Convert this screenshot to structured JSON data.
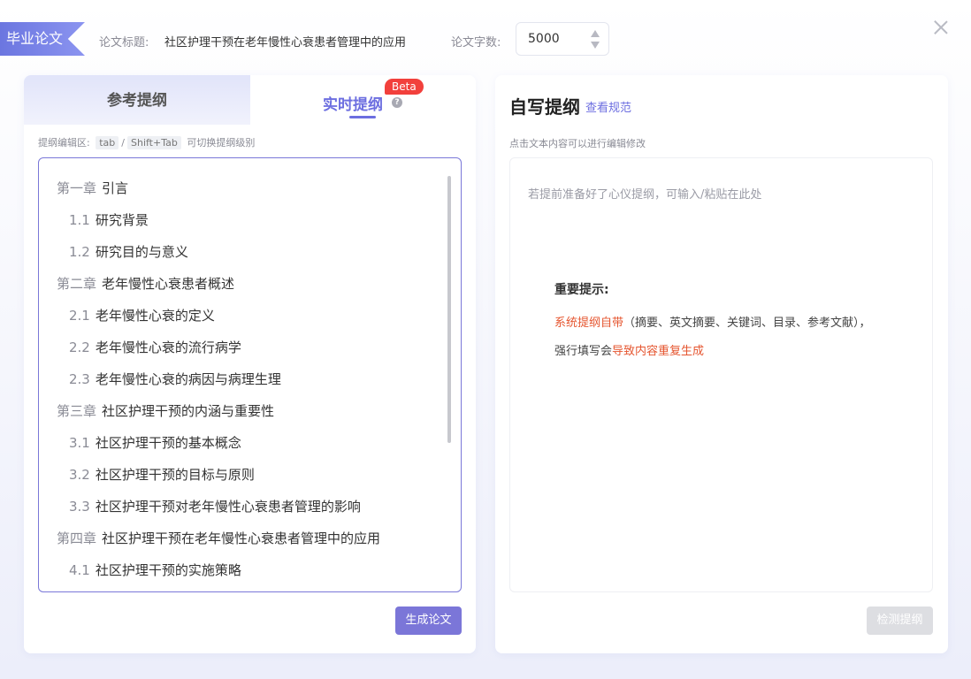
{
  "header": {
    "tag": "毕业论文",
    "title_label": "论文标题:",
    "title_value": "社区护理干预在老年慢性心衰患者管理中的应用",
    "count_label": "论文字数:",
    "count_value": "5000"
  },
  "left": {
    "tab_ref": "参考提纲",
    "tab_live": "实时提纲",
    "beta": "Beta",
    "hint_prefix": "提纲编辑区:",
    "key_tab": "tab",
    "sep": "/",
    "key_shift": "Shift+Tab",
    "hint_suffix": "可切换提纲级别",
    "outline": [
      {
        "level": "ch",
        "num": "第一章",
        "text": "引言"
      },
      {
        "level": "sec",
        "num": "1.1",
        "text": "研究背景"
      },
      {
        "level": "sec",
        "num": "1.2",
        "text": "研究目的与意义"
      },
      {
        "level": "ch",
        "num": "第二章",
        "text": "老年慢性心衰患者概述"
      },
      {
        "level": "sec",
        "num": "2.1",
        "text": "老年慢性心衰的定义"
      },
      {
        "level": "sec",
        "num": "2.2",
        "text": "老年慢性心衰的流行病学"
      },
      {
        "level": "sec",
        "num": "2.3",
        "text": "老年慢性心衰的病因与病理生理"
      },
      {
        "level": "ch",
        "num": "第三章",
        "text": "社区护理干预的内涵与重要性"
      },
      {
        "level": "sec",
        "num": "3.1",
        "text": "社区护理干预的基本概念"
      },
      {
        "level": "sec",
        "num": "3.2",
        "text": "社区护理干预的目标与原则"
      },
      {
        "level": "sec",
        "num": "3.3",
        "text": "社区护理干预对老年慢性心衰患者管理的影响"
      },
      {
        "level": "ch",
        "num": "第四章",
        "text": "社区护理干预在老年慢性心衰患者管理中的应用"
      },
      {
        "level": "sec",
        "num": "4.1",
        "text": "社区护理干预的实施策略"
      }
    ],
    "generate_btn": "生成论文"
  },
  "right": {
    "title": "自写提纲",
    "spec_link": "查看规范",
    "hint": "点击文本内容可以进行编辑修改",
    "placeholder": "若提前准备好了心仪提纲，可输入/粘贴在此处",
    "notice_title": "重要提示:",
    "notice_hl1": "系统提纲自带",
    "notice_text1": "（摘要、英文摘要、关键词、目录、参考文献），",
    "notice_text2": "强行填写会",
    "notice_hl2": "导致内容重复生成",
    "check_btn": "检测提纲"
  },
  "colors": {
    "accent": "#6c6ee0",
    "button": "#7b76d8",
    "warning": "#e5552f",
    "beta": "#f2403c"
  }
}
